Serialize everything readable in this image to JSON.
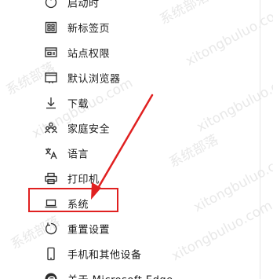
{
  "menu": {
    "items": [
      {
        "label": "启动时",
        "icon": "power-icon"
      },
      {
        "label": "新标签页",
        "icon": "new-tab-icon"
      },
      {
        "label": "站点权限",
        "icon": "site-permissions-icon"
      },
      {
        "label": "默认浏览器",
        "icon": "default-browser-icon"
      },
      {
        "label": "下载",
        "icon": "download-icon"
      },
      {
        "label": "家庭安全",
        "icon": "family-icon"
      },
      {
        "label": "语言",
        "icon": "language-icon"
      },
      {
        "label": "打印机",
        "icon": "printer-icon"
      },
      {
        "label": "系统",
        "icon": "laptop-icon"
      },
      {
        "label": "重置设置",
        "icon": "reset-icon"
      },
      {
        "label": "手机和其他设备",
        "icon": "phone-icon"
      },
      {
        "label": "关于 Microsoft Edge",
        "icon": "edge-logo-icon"
      }
    ]
  },
  "annotation": {
    "highlight_color": "#e02020",
    "arrow_color": "#e02020"
  },
  "watermark": {
    "text_cn": "系统部落",
    "text_url": "xitongbuluo.com"
  }
}
